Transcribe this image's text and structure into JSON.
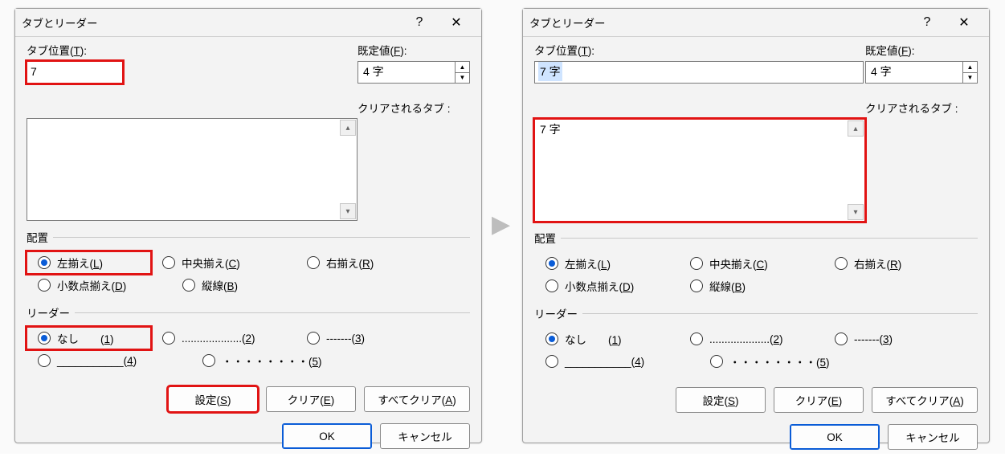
{
  "dialog_title": "タブとリーダー",
  "labels": {
    "tab_pos": "タブ位置(<u>T</u>):",
    "default": "既定値(<u>F</u>):",
    "cleared_tabs": "クリアされるタブ :",
    "align_section": "配置",
    "leader_section": "リーダー"
  },
  "default_value": "4 字",
  "align": {
    "left": "左揃え(<u>L</u>)",
    "center": "中央揃え(<u>C</u>)",
    "right": "右揃え(<u>R</u>)",
    "decimal": "小数点揃え(<u>D</u>)",
    "bar": "縦線(<u>B</u>)"
  },
  "leader": {
    "none": "なし　　(<u>1</u>)",
    "dots": "....................(<u>2</u>)",
    "dash": "-------(<u>3</u>)",
    "under": "___________(<u>4</u>)",
    "mid": "・・・・・・・・(<u>5</u>)"
  },
  "buttons": {
    "set": "設定(<u>S</u>)",
    "clear": "クリア(<u>E</u>)",
    "clearall": "すべてクリア(<u>A</u>)",
    "ok": "OK",
    "cancel": "キャンセル"
  },
  "left_dialog": {
    "pos_value": "7",
    "list_items": []
  },
  "right_dialog": {
    "pos_value": "7 字",
    "list_items": [
      "7 字"
    ]
  }
}
